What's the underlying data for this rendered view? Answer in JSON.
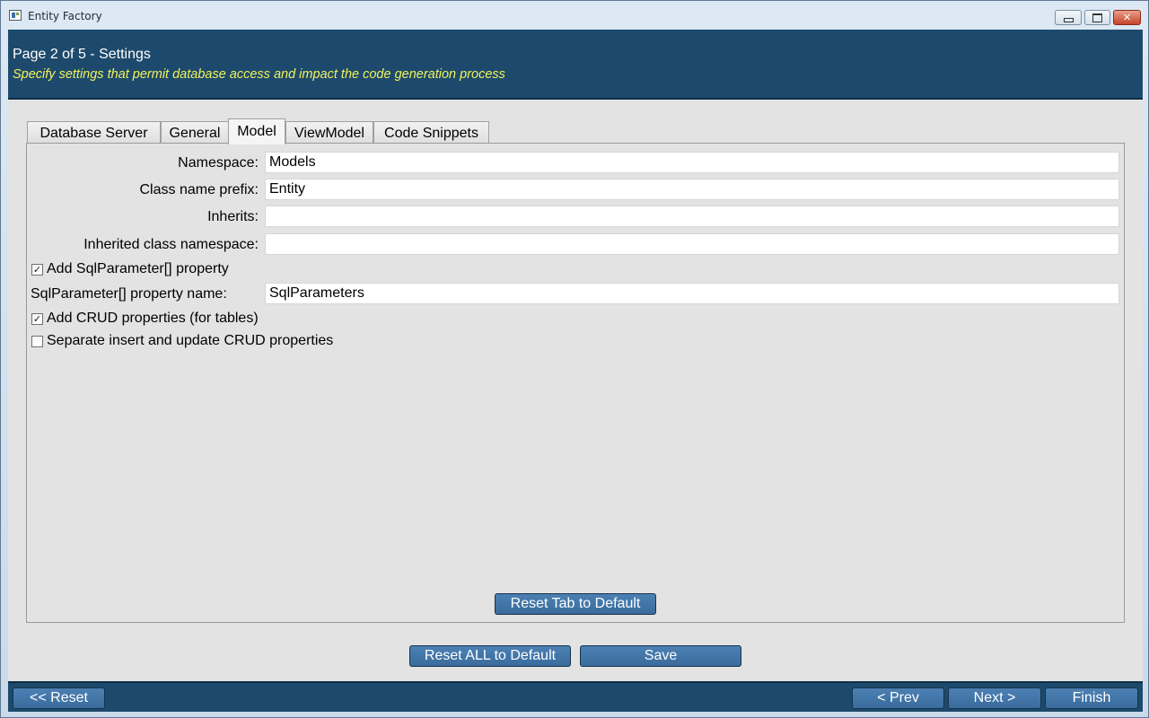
{
  "window": {
    "title": "Entity Factory"
  },
  "header": {
    "title": "Page 2 of 5 - Settings",
    "subtitle": "Specify settings that permit database access and impact the code generation process"
  },
  "tabs": [
    {
      "label": "Database Server",
      "active": false
    },
    {
      "label": "General",
      "active": false
    },
    {
      "label": "Model",
      "active": true
    },
    {
      "label": "ViewModel",
      "active": false
    },
    {
      "label": "Code Snippets",
      "active": false
    }
  ],
  "model_tab": {
    "namespace_label": "Namespace:",
    "namespace_value": "Models",
    "class_prefix_label": "Class name prefix:",
    "class_prefix_value": "Entity",
    "inherits_label": "Inherits:",
    "inherits_value": "",
    "inherited_ns_label": "Inherited class namespace:",
    "inherited_ns_value": "",
    "add_sqlparam_label": "Add SqlParameter[] property",
    "add_sqlparam_checked": true,
    "sqlparam_name_label": "SqlParameter[] property name:",
    "sqlparam_name_value": "SqlParameters",
    "add_crud_label": "Add CRUD properties (for tables)",
    "add_crud_checked": true,
    "separate_crud_label": "Separate insert and update CRUD properties",
    "separate_crud_checked": false,
    "reset_tab_label": "Reset Tab to Default"
  },
  "actions": {
    "reset_all_label": "Reset ALL to Default",
    "save_label": "Save"
  },
  "footer": {
    "reset_label": "<< Reset",
    "prev_label": "< Prev",
    "next_label": "Next >",
    "finish_label": "Finish"
  },
  "colors": {
    "header_bg": "#1d4a6c",
    "subtitle": "#f1f25a",
    "button_bg": "#4579ab",
    "panel_bg": "#e3e3e3"
  }
}
